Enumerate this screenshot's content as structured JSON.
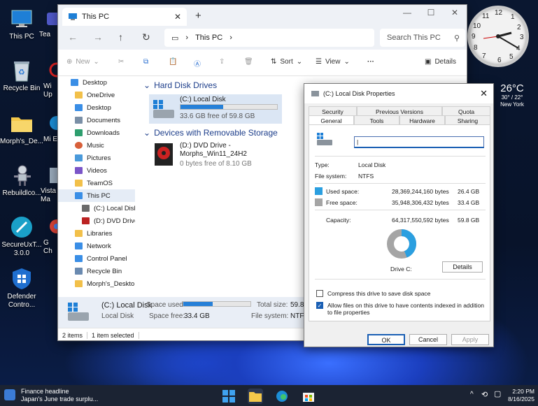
{
  "desktop": {
    "icons": [
      {
        "label": "This PC"
      },
      {
        "label": "Recycle Bin"
      },
      {
        "label": "Morph's_De..."
      },
      {
        "label": "Rebuildlco..."
      },
      {
        "label": "SecureUxT... 3.0.0"
      },
      {
        "label": "Defender Contro..."
      }
    ],
    "partial_icons": [
      {
        "label": "Tea"
      },
      {
        "label": "Wi Up"
      },
      {
        "label": "Mi E"
      },
      {
        "label": "Vista Ma"
      },
      {
        "label": "G Ch"
      }
    ]
  },
  "clock": {
    "numbers": [
      "12",
      "1",
      "2",
      "3",
      "4",
      "5",
      "6",
      "7",
      "8",
      "9",
      "10",
      "11"
    ]
  },
  "weather": {
    "temp": "26°C",
    "range": "30° / 22°",
    "city": "New York"
  },
  "explorer": {
    "tab_title": "This PC",
    "address": "This PC",
    "search_placeholder": "Search This PC",
    "toolbar": {
      "new_label": "New",
      "sort_label": "Sort",
      "view_label": "View",
      "more_label": "···",
      "details_label": "Details"
    },
    "nav": [
      {
        "label": "Desktop",
        "color": "#3a8ee6"
      },
      {
        "label": "OneDrive",
        "color": "#f2c04a"
      },
      {
        "label": "Desktop",
        "color": "#3a8ee6"
      },
      {
        "label": "Documents",
        "color": "#7a8fa6"
      },
      {
        "label": "Downloads",
        "color": "#2e9e6e"
      },
      {
        "label": "Music",
        "color": "#d8603a"
      },
      {
        "label": "Pictures",
        "color": "#4a9adb"
      },
      {
        "label": "Videos",
        "color": "#7a55c8"
      },
      {
        "label": "TeamOS",
        "color": "#f2c04a"
      },
      {
        "label": "This PC",
        "color": "#3a8ee6"
      },
      {
        "label": "(C:) Local Disk",
        "color": "#6a6a6a"
      },
      {
        "label": "(D:) DVD Drive",
        "color": "#b22"
      },
      {
        "label": "Libraries",
        "color": "#f2c04a"
      },
      {
        "label": "Network",
        "color": "#3a8ee6"
      },
      {
        "label": "Control Panel",
        "color": "#3a8ee6"
      },
      {
        "label": "Recycle Bin",
        "color": "#6a8ab0"
      },
      {
        "label": "Morph's_Deskto",
        "color": "#f2c04a"
      }
    ],
    "groups": {
      "hdd": "Hard Disk Drives",
      "removable": "Devices with Removable Storage"
    },
    "drive_c": {
      "name": "(C:) Local Disk",
      "free_text": "33.6 GB free of 59.8 GB",
      "used_fraction": 0.44
    },
    "drive_d": {
      "name": "(D:) DVD Drive - Morphs_Win11_24H2",
      "free_text": "0 bytes free of 8.10 GB"
    },
    "details_pane": {
      "name": "(C:) Local Disk",
      "type": "Local Disk",
      "space_used_label": "Space used:",
      "space_free_label": "Space free:",
      "space_free": "33.4 GB",
      "total_size_label": "Total size:",
      "total_size": "59.8 G",
      "fs_label": "File system:",
      "fs": "NTFS",
      "used_fraction": 0.44
    },
    "status": {
      "items": "2 items",
      "selected": "1 item selected"
    }
  },
  "props": {
    "title": "(C:) Local Disk Properties",
    "tabs_row1": [
      "Security",
      "Previous Versions",
      "Quota"
    ],
    "tabs_row2": [
      "General",
      "Tools",
      "Hardware",
      "Sharing"
    ],
    "type_label": "Type:",
    "type": "Local Disk",
    "fs_label": "File system:",
    "fs": "NTFS",
    "used_label": "Used space:",
    "used_bytes": "28,369,244,160 bytes",
    "used_gb": "26.4 GB",
    "free_label": "Free space:",
    "free_bytes": "35,948,306,432 bytes",
    "free_gb": "33.4 GB",
    "cap_label": "Capacity:",
    "cap_bytes": "64,317,550,592 bytes",
    "cap_gb": "59.8 GB",
    "drive_label": "Drive C:",
    "details_btn": "Details",
    "compress_label": "Compress this drive to save disk space",
    "index_label": "Allow files on this drive to have contents indexed in addition to file properties",
    "ok": "OK",
    "cancel": "Cancel",
    "apply": "Apply",
    "colors": {
      "used": "#2b9fe0",
      "free": "#a5a5a5"
    },
    "used_fraction": 0.44
  },
  "taskbar": {
    "news_title": "Finance headline",
    "news_text": "Japan's June trade surplu...",
    "time": "2:20 PM",
    "date": "8/16/2025"
  }
}
